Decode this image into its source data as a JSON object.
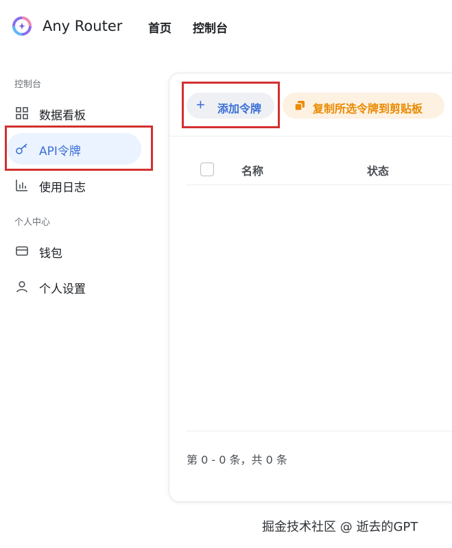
{
  "header": {
    "app_title": "Any Router",
    "nav": {
      "home": "首页",
      "console": "控制台"
    }
  },
  "sidebar": {
    "section_console": "控制台",
    "section_personal": "个人中心",
    "items": [
      {
        "label": "数据看板",
        "icon": "dashboard-grid-icon"
      },
      {
        "label": "API令牌",
        "icon": "key-icon",
        "active": true
      },
      {
        "label": "使用日志",
        "icon": "bar-chart-icon"
      },
      {
        "label": "钱包",
        "icon": "wallet-card-icon"
      },
      {
        "label": "个人设置",
        "icon": "user-icon"
      }
    ]
  },
  "toolbar": {
    "add_label": "添加令牌",
    "copy_label": "复制所选令牌到剪贴板"
  },
  "table": {
    "columns": [
      "名称",
      "状态"
    ],
    "pager_text": "第 0 - 0 条，共 0 条"
  },
  "watermark": "掘金技术社区 @ 逝去的GPT",
  "colors": {
    "accent": "#3b6fd6",
    "active_bg": "#eaf3ff",
    "copy_text": "#ea8a00",
    "copy_bg": "#fdf1e2",
    "highlight": "#d32f2f"
  }
}
